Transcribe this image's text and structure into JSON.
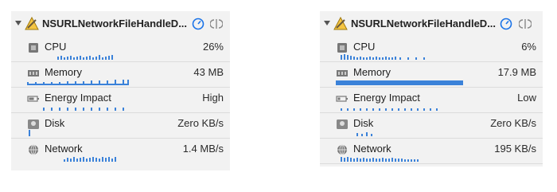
{
  "panels": [
    {
      "process_name": "NSURLNetworkFileHandleD...",
      "rows": [
        {
          "label": "CPU",
          "value": "26%"
        },
        {
          "label": "Memory",
          "value": "43 MB"
        },
        {
          "label": "Energy Impact",
          "value": "High"
        },
        {
          "label": "Disk",
          "value": "Zero KB/s"
        },
        {
          "label": "Network",
          "value": "1.4 MB/s"
        }
      ]
    },
    {
      "process_name": "NSURLNetworkFileHandleD...",
      "rows": [
        {
          "label": "CPU",
          "value": "6%"
        },
        {
          "label": "Memory",
          "value": "17.9 MB"
        },
        {
          "label": "Energy Impact",
          "value": "Low"
        },
        {
          "label": "Disk",
          "value": "Zero KB/s"
        },
        {
          "label": "Network",
          "value": "195 KB/s"
        }
      ]
    }
  ],
  "icons": {
    "app": "xcode-app-icon",
    "gauge": "debug-gauge-icon",
    "split": "split-view-icon",
    "cpu": "cpu-chip-icon",
    "memory": "memory-module-icon",
    "energy": "battery-icon",
    "disk": "disk-drive-icon",
    "network": "globe-icon"
  },
  "colors": {
    "accent": "#1a73e8",
    "sparkline": "#3b82d9",
    "panel_bg": "#f2f2f2",
    "separator": "#dcdcdc"
  }
}
